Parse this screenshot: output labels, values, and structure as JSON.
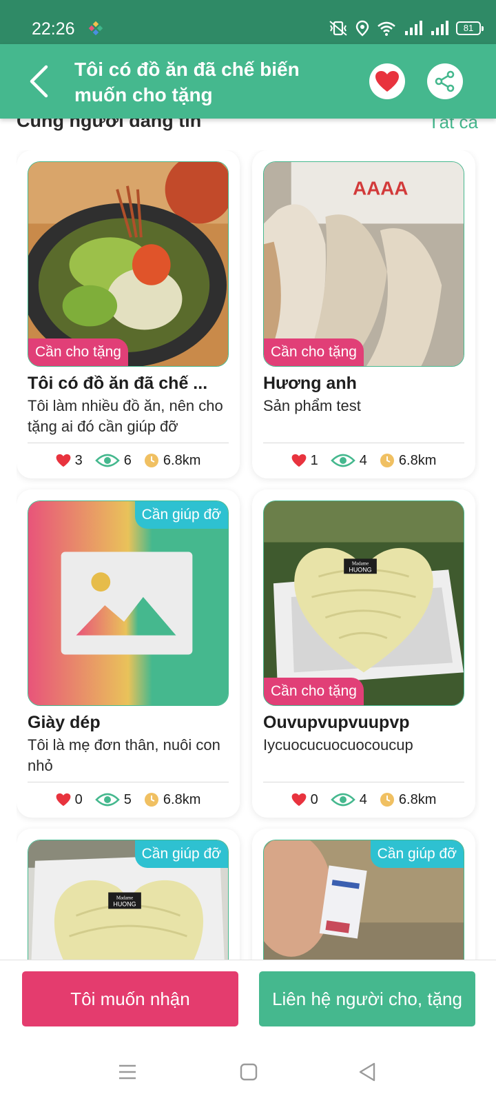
{
  "status_bar": {
    "time": "22:26",
    "battery": "81"
  },
  "header": {
    "title": "Tôi có đồ ăn đã chế biến muốn cho tặng"
  },
  "section": {
    "title": "Cùng người đăng tin",
    "see_all": "Tất cả"
  },
  "cards": [
    {
      "badge": "Cần cho tặng",
      "title": "Tôi có đồ ăn đã chế ...",
      "description": "Tôi làm nhiều đồ ăn,  nên cho tặng ai đó cần giúp đỡ",
      "likes": "3",
      "views": "6",
      "distance": "6.8km"
    },
    {
      "badge": "Cần cho tặng",
      "title": "Hương anh",
      "description": "Sản phẩm test",
      "likes": "1",
      "views": "4",
      "distance": "6.8km"
    },
    {
      "badge": "Cần giúp đỡ",
      "title": "Giày dép",
      "description": "Tôi là mẹ đơn thân, nuôi con nhỏ",
      "likes": "0",
      "views": "5",
      "distance": "6.8km"
    },
    {
      "badge": "Cần cho tặng",
      "title": "Ouvupvupvuupvp",
      "description": "Iycuocucuocuocoucup",
      "likes": "0",
      "views": "4",
      "distance": "6.8km"
    },
    {
      "badge": "Cần giúp đỡ",
      "cake_label_line1": "Madame",
      "cake_label_line2": "HUONG"
    },
    {
      "badge": "Cần giúp đỡ"
    }
  ],
  "cake_label": {
    "line1": "Madame",
    "line2": "HUONG"
  },
  "package_text": "AAAA",
  "actions": {
    "receive": "Tôi muốn nhận",
    "contact": "Liên hệ người cho, tặng"
  },
  "colors": {
    "primary": "#45b88e",
    "status_bar": "#2f8a66",
    "pink": "#e43c6e",
    "help_badge": "#2ec1d1"
  },
  "icons": [
    "back-arrow-icon",
    "heart-icon",
    "share-icon",
    "eye-icon",
    "clock-icon",
    "menu-icon",
    "home-icon",
    "back-triangle-icon"
  ]
}
